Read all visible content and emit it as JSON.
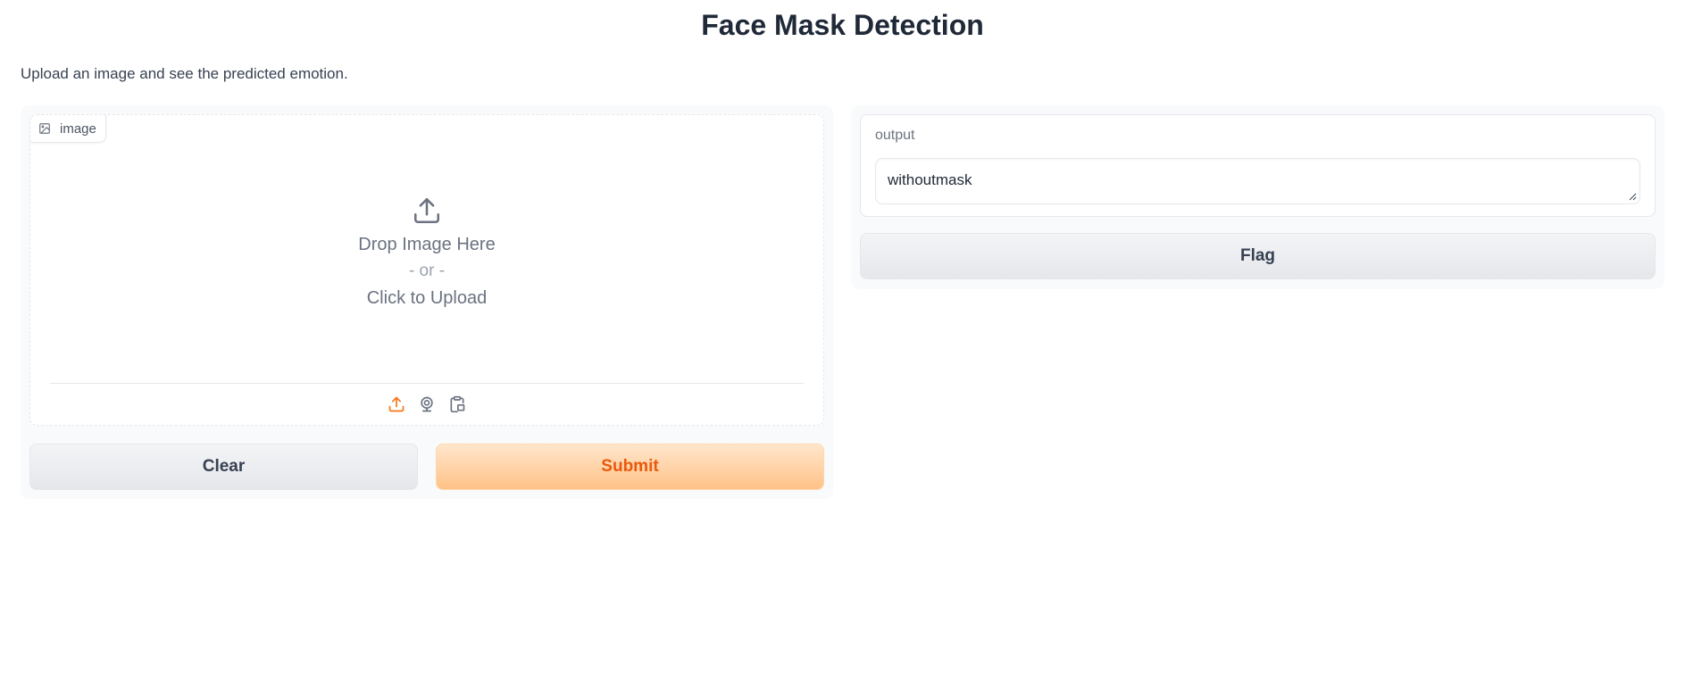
{
  "header": {
    "title": "Face Mask Detection",
    "description": "Upload an image and see the predicted emotion."
  },
  "input_panel": {
    "image_label": "image",
    "drop_text": "Drop Image Here",
    "or_text": "- or -",
    "click_text": "Click to Upload",
    "sources": [
      "upload-icon",
      "webcam-icon",
      "clipboard-icon"
    ],
    "active_source_color": "#f97316"
  },
  "actions": {
    "clear_label": "Clear",
    "submit_label": "Submit"
  },
  "output_panel": {
    "label": "output",
    "value": "withoutmask",
    "flag_label": "Flag"
  }
}
